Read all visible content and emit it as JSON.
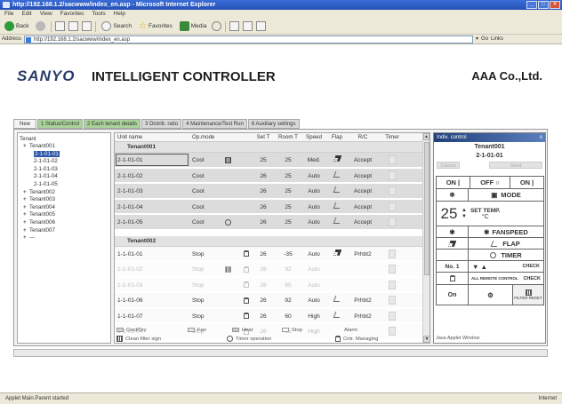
{
  "browser": {
    "title": "http://192.168.1.2/sacwww/index_en.asp - Microsoft Internet Explorer",
    "menu": [
      "File",
      "Edit",
      "View",
      "Favorites",
      "Tools",
      "Help"
    ],
    "toolbar": {
      "back": "Back",
      "search": "Search",
      "favorites": "Favorites",
      "media": "Media"
    },
    "address_label": "Address",
    "address_value": "http://192.168.1.2/sacwww/index_en.asp",
    "go_label": "Go",
    "links_label": "Links",
    "status_left": "Applet Main.Parent started",
    "status_right": "Internet"
  },
  "header": {
    "logo": "SANYO",
    "title": "INTELLIGENT CONTROLLER",
    "company": "AAA Co.,Ltd."
  },
  "tabs": [
    {
      "label": "New"
    },
    {
      "label": "1 Status/Control"
    },
    {
      "label": "2 Each tenant details"
    },
    {
      "label": "3 Distrib. ratio"
    },
    {
      "label": "4 Maintenance/Test Run"
    },
    {
      "label": "6 Auxiliary settings"
    }
  ],
  "tree": {
    "header": "Tenant",
    "items": [
      {
        "label": "Tenant001",
        "expander": "+"
      },
      {
        "label": "2-1-01-01"
      },
      {
        "label": "2-1-01-02"
      },
      {
        "label": "2-1-01-03"
      },
      {
        "label": "2-1-01-04"
      },
      {
        "label": "2-1-01-05"
      },
      {
        "label": "Tenant002",
        "expander": "+"
      },
      {
        "label": "Tenant003",
        "expander": "+"
      },
      {
        "label": "Tenant004",
        "expander": "+"
      },
      {
        "label": "Tenant005",
        "expander": "+"
      },
      {
        "label": "Tenant006",
        "expander": "+"
      },
      {
        "label": "Tenant007",
        "expander": "+"
      },
      {
        "label": "---",
        "expander": "+"
      }
    ]
  },
  "grid": {
    "columns": {
      "unit": "Unit name",
      "op": "Op.mode",
      "set": "Set T",
      "room": "Room T",
      "speed": "Speed",
      "flap": "Flap",
      "rc": "R/C",
      "timer": "Timer"
    },
    "groups": [
      {
        "name": "Tenant001",
        "rows": [
          {
            "unit": "2-1-01-01",
            "op": "Cool",
            "set": "25",
            "room": "25",
            "speed": "Med.",
            "rc": "Accept"
          },
          {
            "unit": "2-1-01-02",
            "op": "Cool",
            "set": "26",
            "room": "25",
            "speed": "Auto",
            "rc": "Accept"
          },
          {
            "unit": "2-1-01-03",
            "op": "Cool",
            "set": "26",
            "room": "25",
            "speed": "Auto",
            "rc": "Accept"
          },
          {
            "unit": "2-1-01-04",
            "op": "Cool",
            "set": "26",
            "room": "25",
            "speed": "Auto",
            "rc": "Accept"
          },
          {
            "unit": "2-1-01-05",
            "op": "Cool",
            "set": "26",
            "room": "25",
            "speed": "Auto",
            "rc": "Accept"
          }
        ]
      },
      {
        "name": "Tenant002",
        "rows": [
          {
            "unit": "1-1-01-01",
            "op": "Stop",
            "set": "26",
            "room": "-35",
            "speed": "Auto",
            "rc": "Prhbt2"
          },
          {
            "unit": "1-1-01-02",
            "op": "Stop",
            "set": "26",
            "room": "92",
            "speed": "Auto",
            "rc": ""
          },
          {
            "unit": "1-1-01-03",
            "op": "Stop",
            "set": "26",
            "room": "85",
            "speed": "Auto",
            "rc": ""
          },
          {
            "unit": "1-1-01-06",
            "op": "Stop",
            "set": "26",
            "room": "92",
            "speed": "Auto",
            "rc": "Prhbt2"
          },
          {
            "unit": "1-1-01-07",
            "op": "Stop",
            "set": "26",
            "room": "60",
            "speed": "High",
            "rc": "Prhbt2"
          },
          {
            "unit": "1-1-01-04",
            "op": "Stop",
            "set": "26",
            "room": "85",
            "speed": "High",
            "rc": ""
          }
        ]
      }
    ]
  },
  "legend": {
    "cool_dry": "Cool/Dry",
    "fan": "Fan",
    "heat": "Heat",
    "stop": "Stop",
    "alarm": "Alarm",
    "clean_filter": "Clean filter sign",
    "timer_op": "Timer operation",
    "cntr_managing": "Cntr. Managing"
  },
  "control": {
    "title": "Indiv. control",
    "close": "x",
    "tenant": "Tenant001",
    "unit": "2-1-01-01",
    "cancel": "Cancel",
    "send": "Send",
    "on": "ON",
    "off": "OFF",
    "on2": "ON",
    "mode": "MODE",
    "set_temp_value": "25",
    "set_temp_label": "SET TEMP.",
    "temp_unit": "°C",
    "fanspeed": "FANSPEED",
    "flap": "FLAP",
    "timer": "TIMER",
    "no_label": "No. 1",
    "check": "CHECK",
    "all_remote": "ALL REMOTE CONTROL",
    "check2": "CHECK",
    "on_label": "On",
    "filter_reset": "FILTER RESET",
    "applet_window": "Java Applet Window"
  }
}
